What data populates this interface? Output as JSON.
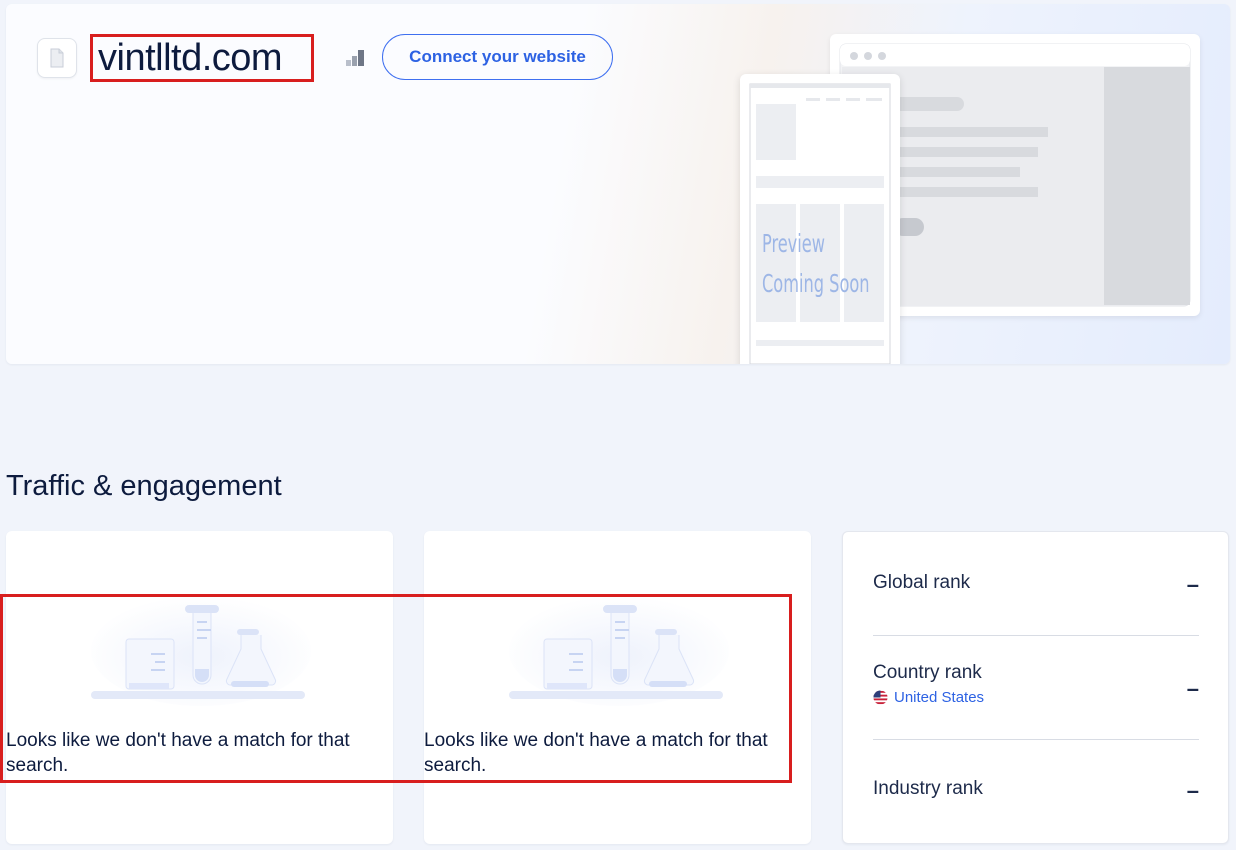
{
  "header": {
    "domain": "vintlltd.com",
    "connect_label": "Connect your website",
    "preview_line1": "Preview",
    "preview_line2": "Coming Soon"
  },
  "section": {
    "title": "Traffic & engagement"
  },
  "cards": {
    "empty_message": "Looks like we don't have a match for that search."
  },
  "ranks": {
    "global_label": "Global rank",
    "global_value": "–",
    "country_label": "Country rank",
    "country_name": "United States",
    "country_value": "–",
    "industry_label": "Industry rank",
    "industry_value": "–"
  },
  "colors": {
    "accent": "#2d62e3",
    "highlight": "#d81e1e",
    "text": "#0d1b3e"
  }
}
